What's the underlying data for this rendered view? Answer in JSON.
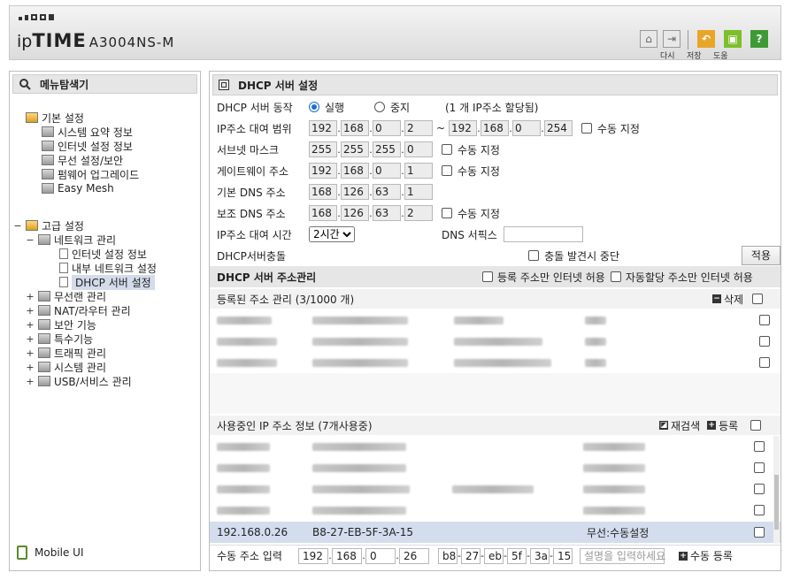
{
  "header": {
    "logo_ip": "ip",
    "logo_time": "TIME",
    "model": "A3004NS-M",
    "buttons": [
      {
        "label": "다시",
        "color": "#e8a628",
        "glyph": "↶"
      },
      {
        "label": "저장",
        "color": "#7cbf2a",
        "glyph": "▣"
      },
      {
        "label": "도움",
        "color": "#3e9a35",
        "glyph": "?"
      }
    ]
  },
  "sidebar": {
    "title": "메뉴탐색기",
    "basic_label": "기본 설정",
    "basic_items": [
      "시스템 요약 정보",
      "인터넷 설정 정보",
      "무선 설정/보안",
      "펌웨어 업그레이드",
      "Easy Mesh"
    ],
    "advanced_label": "고급 설정",
    "network_label": "네트워크 관리",
    "network_items": [
      "인터넷 설정 정보",
      "내부 네트워크 설정",
      "DHCP 서버 설정"
    ],
    "other_items": [
      "무선랜 관리",
      "NAT/라우터 관리",
      "보안 기능",
      "특수기능",
      "트래픽 관리",
      "시스템 관리",
      "USB/서비스 관리"
    ],
    "mobile_label": "Mobile UI"
  },
  "main": {
    "title": "DHCP 서버 설정",
    "dhcp_action_label": "DHCP 서버 동작",
    "run_label": "실행",
    "stop_label": "중지",
    "ip_alloc_note": "(1 개 IP주소 할당됨)",
    "range_label": "IP주소 대여 범위",
    "range_start": [
      "192",
      "168",
      "0",
      "2"
    ],
    "range_tilde": "~",
    "range_end": [
      "192",
      "168",
      "0",
      "254"
    ],
    "manual_label": "수동 지정",
    "subnet_label": "서브넷 마스크",
    "subnet": [
      "255",
      "255",
      "255",
      "0"
    ],
    "gateway_label": "게이트웨이 주소",
    "gateway": [
      "192",
      "168",
      "0",
      "1"
    ],
    "dns1_label": "기본 DNS 주소",
    "dns1": [
      "168",
      "126",
      "63",
      "1"
    ],
    "dns2_label": "보조 DNS 주소",
    "dns2": [
      "168",
      "126",
      "63",
      "2"
    ],
    "lease_label": "IP주소 대여 시간",
    "lease_value": "2시간",
    "dns_suffix_label": "DNS 서픽스",
    "conflict_label": "DHCP서버충돌",
    "conflict_stop_label": "충돌 발견시 중단",
    "apply_label": "적용",
    "addr_mgmt_title": "DHCP 서버 주소관리",
    "registered_only_label": "등록 주소만 인터넷 허용",
    "auto_only_label": "자동할당 주소만 인터넷 허용",
    "registered_header": "등록된 주소 관리 (3/1000 개)",
    "delete_label": "삭제",
    "inuse_header": "사용중인 IP 주소 정보 (7개사용중)",
    "rescan_label": "재검색",
    "register_label": "등록",
    "highlight_row": {
      "ip": "192.168.0.26",
      "mac": "B8-27-EB-5F-3A-15",
      "type": "무선:수동설정"
    },
    "manual_input_label": "수동 주소 입력",
    "manual_ip": [
      "192",
      "168",
      "0",
      "26"
    ],
    "manual_mac": [
      "b8",
      "27",
      "eb",
      "5f",
      "3a",
      "15"
    ],
    "desc_placeholder": "설명을 입력하세요",
    "manual_register_label": "수동 등록"
  }
}
